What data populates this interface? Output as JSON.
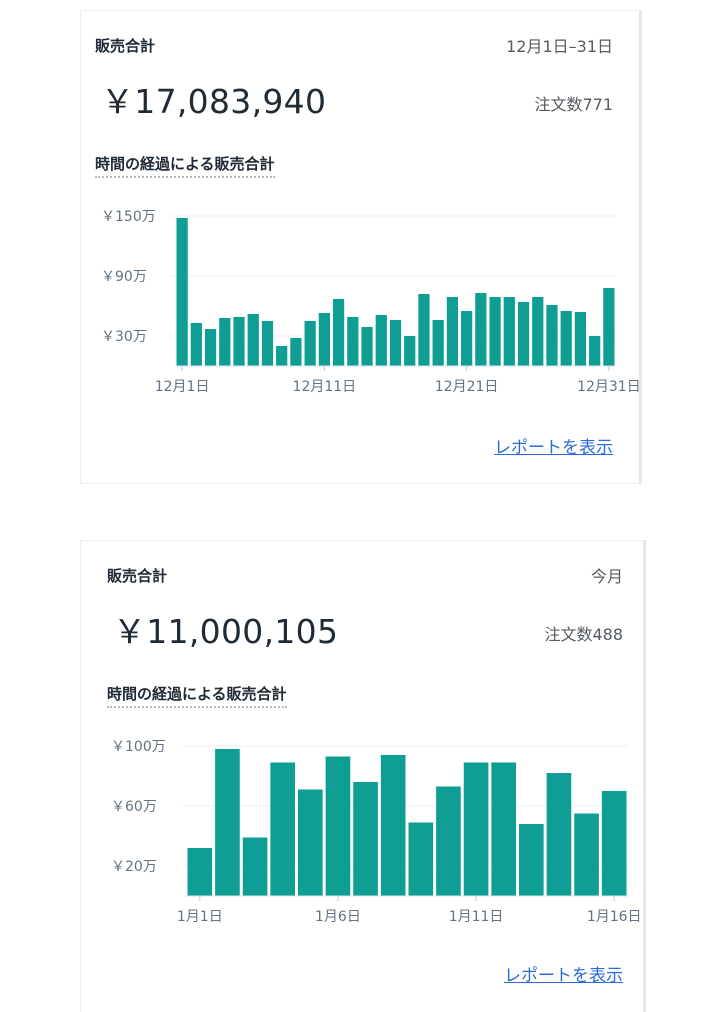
{
  "colors": {
    "bar": "#0e9e94",
    "link": "#2b6cd6"
  },
  "cards": [
    {
      "title": "販売合計",
      "period": "12月1日–31日",
      "total": "￥17,083,940",
      "orders": "注文数771",
      "subtitle": "時間の経過による販売合計",
      "report_link": "レポートを表示",
      "chart_data": {
        "type": "bar",
        "y_ticks": [
          "￥150万",
          "￥90万",
          "￥30万"
        ],
        "y_tick_values": [
          150,
          90,
          30
        ],
        "y_max": 150,
        "x_labels": [
          "12月1日",
          "12月11日",
          "12月21日",
          "12月31日"
        ],
        "x_label_indices": [
          0,
          10,
          20,
          30
        ],
        "ylabel_unit": "万",
        "categories": [
          "12/1",
          "12/2",
          "12/3",
          "12/4",
          "12/5",
          "12/6",
          "12/7",
          "12/8",
          "12/9",
          "12/10",
          "12/11",
          "12/12",
          "12/13",
          "12/14",
          "12/15",
          "12/16",
          "12/17",
          "12/18",
          "12/19",
          "12/20",
          "12/21",
          "12/22",
          "12/23",
          "12/24",
          "12/25",
          "12/26",
          "12/27",
          "12/28",
          "12/29",
          "12/30",
          "12/31"
        ],
        "values": [
          148,
          43,
          37,
          48,
          49,
          52,
          45,
          20,
          28,
          45,
          53,
          67,
          49,
          39,
          51,
          46,
          30,
          72,
          46,
          69,
          55,
          73,
          69,
          69,
          64,
          69,
          61,
          55,
          54,
          30,
          78
        ]
      }
    },
    {
      "title": "販売合計",
      "period": "今月",
      "total": "￥11,000,105",
      "orders": "注文数488",
      "subtitle": "時間の経過による販売合計",
      "report_link": "レポートを表示",
      "chart_data": {
        "type": "bar",
        "y_ticks": [
          "￥100万",
          "￥60万",
          "￥20万"
        ],
        "y_tick_values": [
          100,
          60,
          20
        ],
        "y_max": 100,
        "x_labels": [
          "1月1日",
          "1月6日",
          "1月11日",
          "1月16日"
        ],
        "x_label_indices": [
          0,
          5,
          10,
          15
        ],
        "ylabel_unit": "万",
        "categories": [
          "1/1",
          "1/2",
          "1/3",
          "1/4",
          "1/5",
          "1/6",
          "1/7",
          "1/8",
          "1/9",
          "1/10",
          "1/11",
          "1/12",
          "1/13",
          "1/14",
          "1/15",
          "1/16"
        ],
        "values": [
          32,
          98,
          39,
          89,
          71,
          93,
          76,
          94,
          49,
          73,
          89,
          89,
          48,
          82,
          55,
          70
        ]
      }
    }
  ]
}
